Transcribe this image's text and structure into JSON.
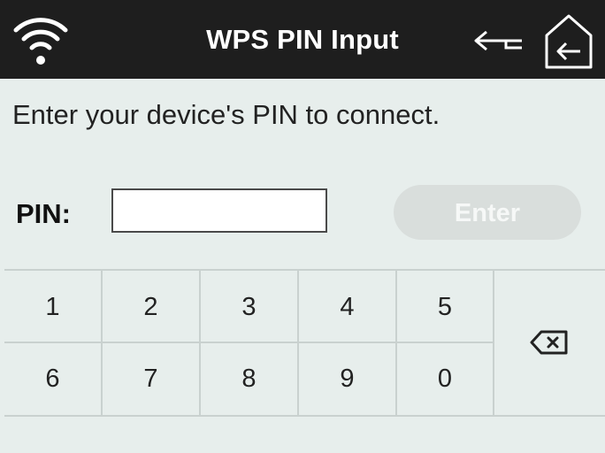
{
  "header": {
    "title": "WPS PIN Input",
    "wifi_icon": "wifi-icon",
    "back_icon": "back-arrow-icon",
    "home_icon": "home-exit-icon"
  },
  "prompt": "Enter your device's PIN to connect.",
  "pin": {
    "label": "PIN:",
    "value": "",
    "placeholder": ""
  },
  "enter_button": {
    "label": "Enter",
    "state": "disabled"
  },
  "keypad": {
    "row1": [
      "1",
      "2",
      "3",
      "4",
      "5"
    ],
    "row2": [
      "6",
      "7",
      "8",
      "9",
      "0"
    ],
    "backspace_icon": "backspace-icon"
  },
  "colors": {
    "header_bg": "#1e1e1e",
    "page_bg": "#e7eeec",
    "button_disabled": "#d9dedc",
    "grid_line": "#c9d1cf"
  }
}
